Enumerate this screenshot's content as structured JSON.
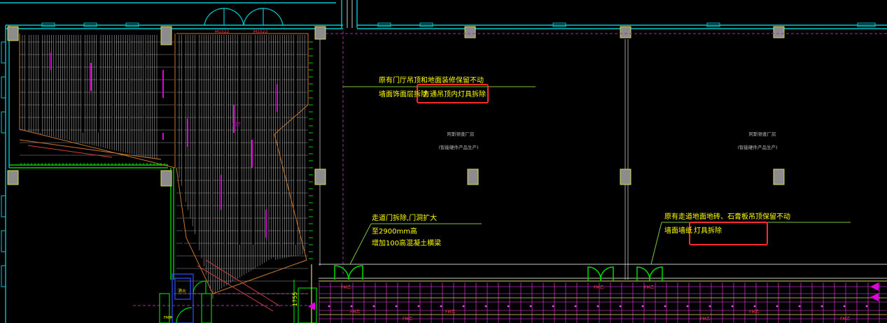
{
  "palette": {
    "background": "#000000",
    "wall": "#00c8d0",
    "wall_light": "#e0f8ff",
    "column": "#8c8c8c",
    "annotation_text": "#ffff00",
    "leader_green": "#7fbf3f",
    "highlight_box": "#ff2a2a",
    "door_green": "#00d000",
    "grid_magenta": "#ff40ff",
    "grid_yellow": "#d8d858",
    "hatch_white": "#c8c8c8",
    "ceiling_orange": "#c87830",
    "light_magenta": "#e000e0",
    "dim_gray": "#7a7a7a",
    "dashed_magenta": "#a030a0"
  },
  "annotations": {
    "note_hall_line1": "原有门厅吊顶和地面装修保留不动",
    "note_hall_line2_prefix": "墙面饰面层拆除",
    "note_hall_line2_highlight": "方通吊顶内灯具拆除",
    "note_door_line1": "走道门拆除,门洞扩大",
    "note_door_line2": "至2900mm高",
    "note_door_line3": "增加100高混凝土横梁",
    "note_corridor_line1": "原有走道地面地砖、石膏板吊顶保留不动",
    "note_corridor_line2_prefix": "墙面墙纸",
    "note_corridor_line2_highlight": "灯具拆除"
  },
  "room_labels": {
    "room1_name": "阿斯顿查厂房",
    "room1_sub": "(智能硬件产品生产)",
    "room2_name": "阿斯顿查厂房",
    "room2_sub": "(智能硬件产品生产)"
  },
  "small_labels": {
    "door_tag_1": "M1522",
    "door_tag_2": "M1522",
    "fire_label": "消火",
    "dim_vertical": "1755",
    "stair_mark": "FM甲",
    "corridor_tag_1": "FM乙",
    "corridor_tag_2": "FM乙",
    "corridor_tag_3": "FM乙",
    "corridor_tag_4": "FM乙",
    "corridor_tag_5": "FM乙",
    "corridor_tag_6": "FM乙",
    "corridor_tag_7": "FM乙",
    "corridor_tag_8": "FM乙",
    "corridor_tag_9": "FM乙",
    "room_center_mark": "门厅"
  }
}
